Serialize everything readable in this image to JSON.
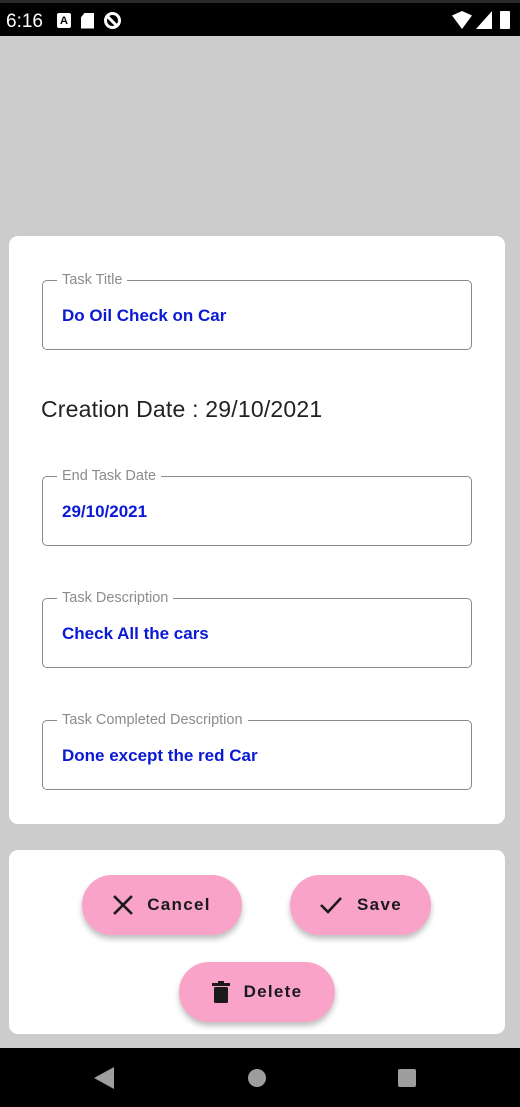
{
  "status_bar": {
    "time": "6:16",
    "notification_a": "A"
  },
  "form": {
    "task_title": {
      "label": "Task Title",
      "value": "Do Oil Check on Car"
    },
    "creation_date": "Creation Date : 29/10/2021",
    "end_task_date": {
      "label": "End Task Date",
      "value": "29/10/2021"
    },
    "task_description": {
      "label": "Task Description",
      "value": "Check All the cars"
    },
    "task_completed_description": {
      "label": "Task Completed Description",
      "value": "Done except the red Car"
    }
  },
  "actions": {
    "cancel_label": "Cancel",
    "save_label": "Save",
    "delete_label": "Delete"
  },
  "colors": {
    "accent_button": "#f9a3c8",
    "value_text": "#0a19d6",
    "backdrop": "#cccccc"
  },
  "icons": {
    "cancel": "close-icon",
    "save": "check-icon",
    "delete": "trash-icon"
  }
}
